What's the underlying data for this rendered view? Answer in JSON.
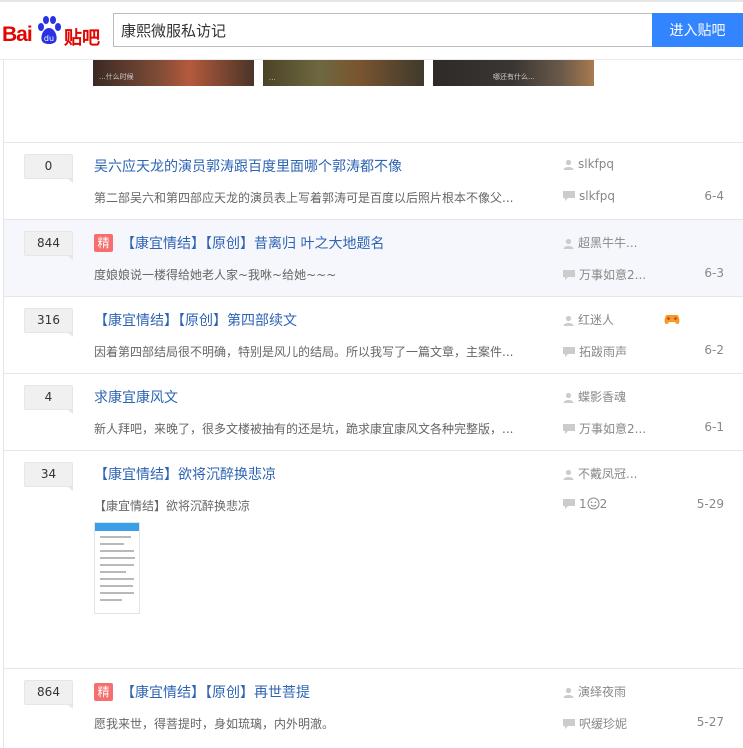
{
  "brand": {
    "bai": "Bai",
    "tieba": "贴吧"
  },
  "search": {
    "value": "康熙微服私访记"
  },
  "enter_button": "进入贴吧",
  "thumbs": [
    "...什么时候",
    "...",
    "哪还有什么..."
  ],
  "threads": [
    {
      "count": "0",
      "featured": false,
      "title": "吴六应天龙的演员郭涛跟百度里面哪个郭涛都不像",
      "abstract": "第二部吴六和第四部应天龙的演员表上写着郭涛可是百度以后照片根本不像父...",
      "author": "slkfpq",
      "last_reply": "slkfpq",
      "date": "6-4"
    },
    {
      "count": "844",
      "featured": true,
      "title": "【康宜情结】【原创】昔离归 叶之大地题名",
      "abstract": "度娘娘说一楼得给她老人家~我咻~给她~~~",
      "author": "超黑牛牛...",
      "last_reply": "万事如意2...",
      "date": "6-3"
    },
    {
      "count": "316",
      "featured": false,
      "title": "【康宜情结】【原创】第四部续文",
      "abstract": "因着第四部结局很不明确，特别是风儿的结局。所以我写了一篇文章，主案件...",
      "author": "红迷人",
      "last_reply": "拓跋雨声",
      "date": "6-2"
    },
    {
      "count": "4",
      "featured": false,
      "title": "求康宜康风文",
      "abstract": "新人拜吧，来晚了，很多文楼被抽有的还是坑，跪求康宜康风文各种完整版，...",
      "author": "蝶影香魂",
      "last_reply": "万事如意2...",
      "date": "6-1"
    },
    {
      "count": "34",
      "featured": false,
      "title": "【康宜情结】欲将沉醉换悲凉",
      "abstract": "【康宜情结】欲将沉醉换悲凉",
      "author": "不戴凤冠...",
      "last_reply_pre": "1",
      "last_reply_post": "2",
      "date": "5-29"
    },
    {
      "count": "864",
      "featured": true,
      "title": "【康宜情结】【原创】再世菩提",
      "abstract": "愿我来世，得菩提时，身如琉璃，内外明澈。",
      "author": "演绎夜雨",
      "last_reply": "呎缓珍妮",
      "date": "5-27"
    }
  ],
  "featured_label": "精",
  "colors": {
    "accent": "#3385ff",
    "link": "#2d64b3",
    "brand_red": "#e10601",
    "featured": "#f66e6e"
  },
  "icons": {
    "author": "user-icon",
    "last_reply": "comment-icon"
  }
}
